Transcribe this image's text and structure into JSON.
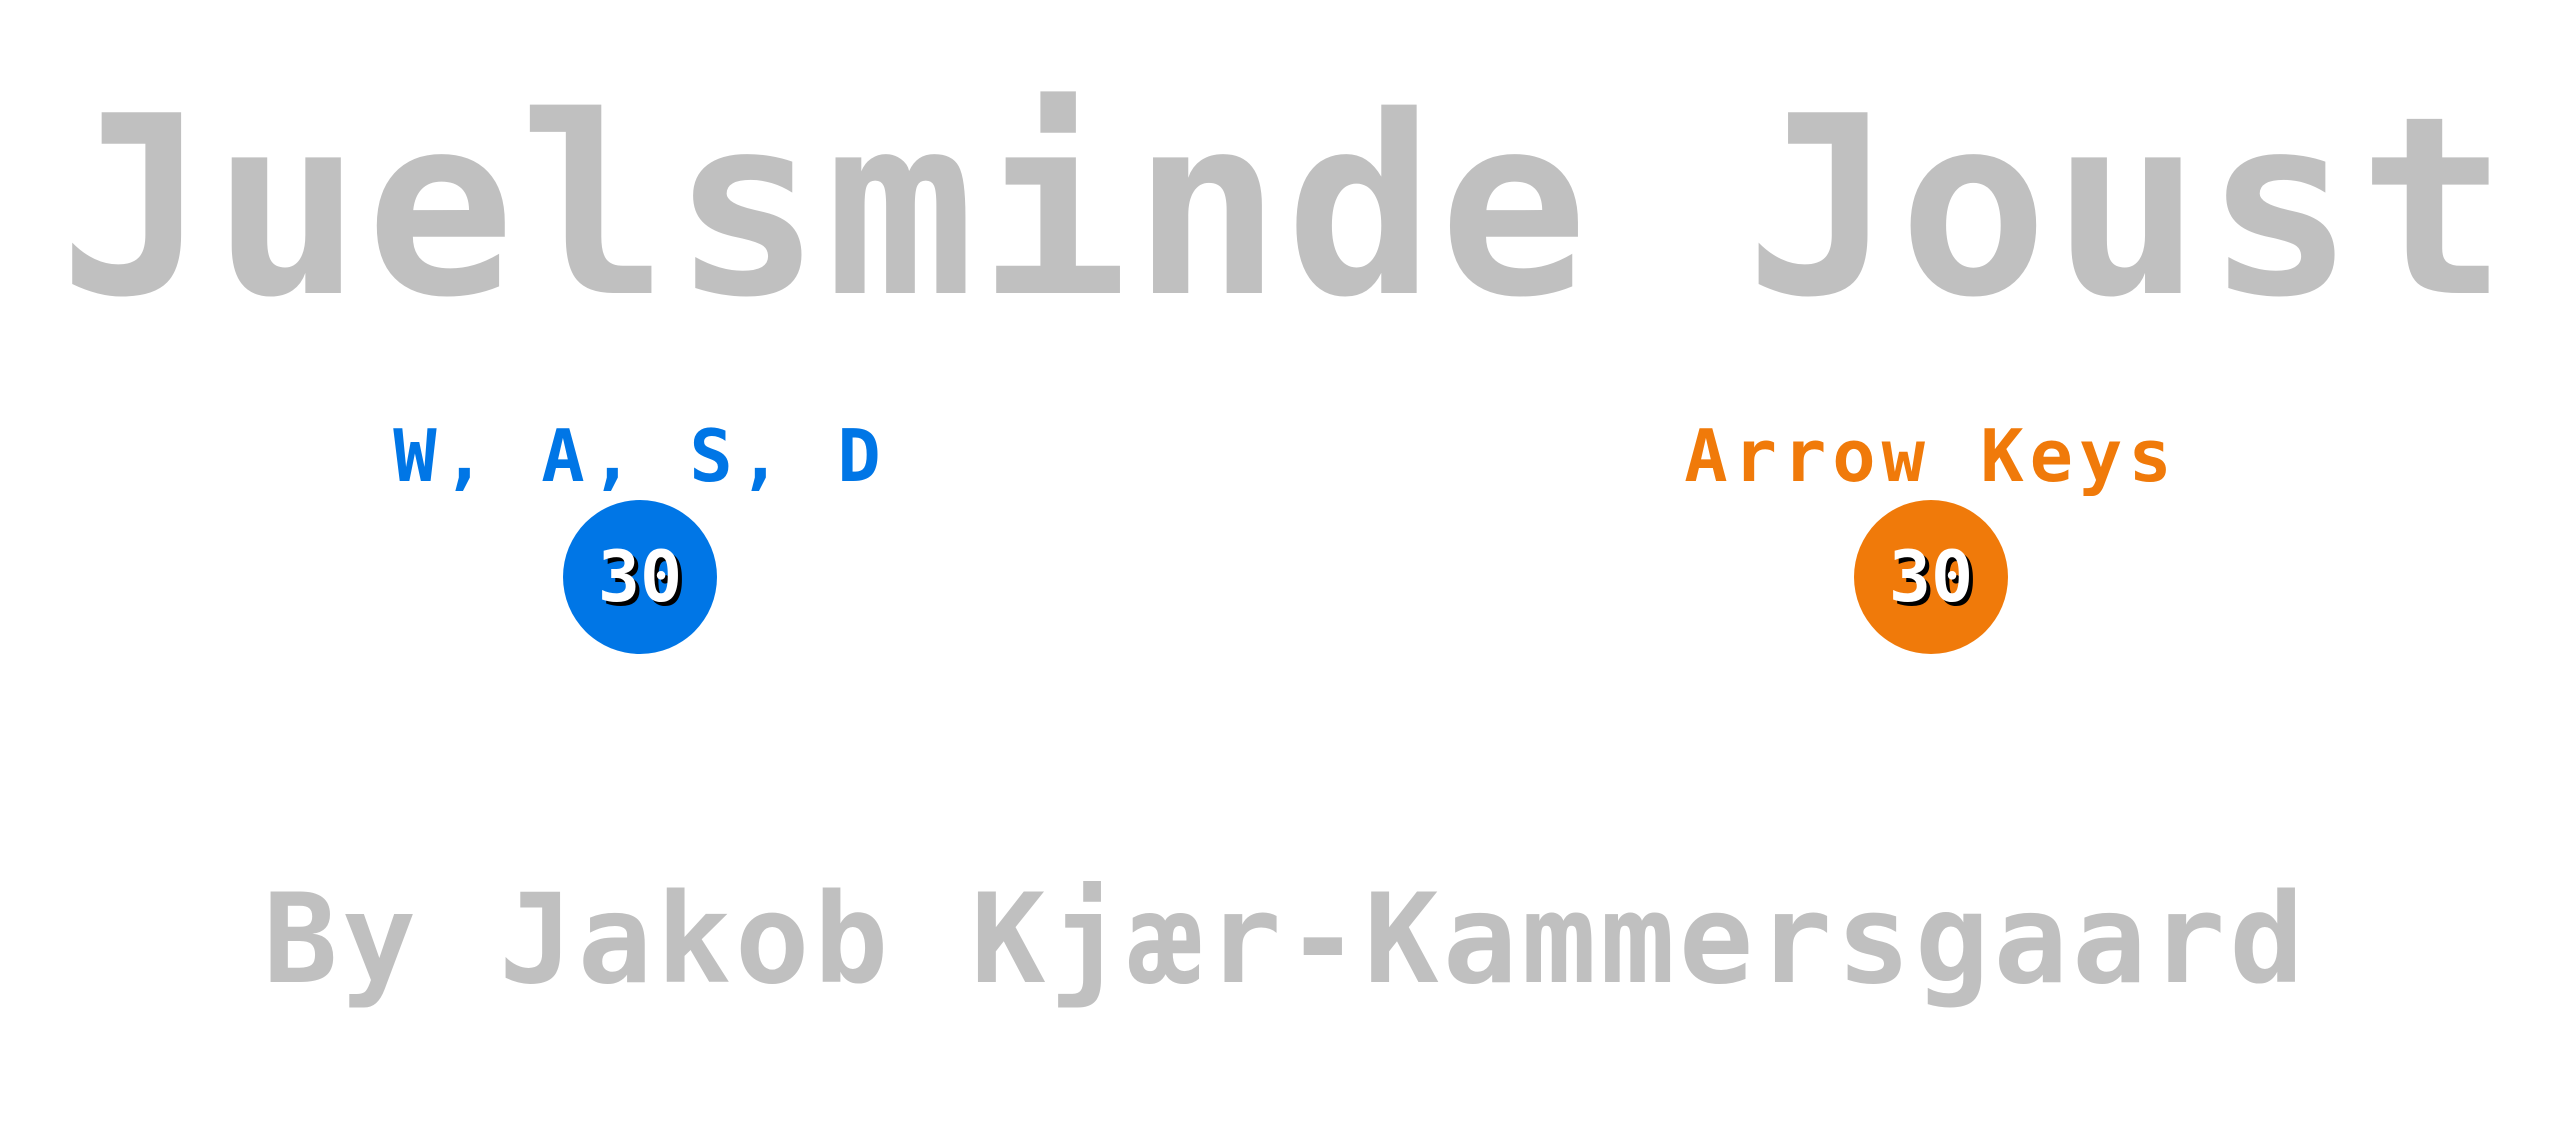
{
  "title": "Juelsminde Joust",
  "colors": {
    "title": "#c0c0c0",
    "player1": "#0076e6",
    "player2": "#f07a0a",
    "score_text": "#ffffff",
    "score_shadow": "#000000",
    "background": "#ffffff"
  },
  "players": [
    {
      "controls": "W, A, S, D",
      "score": "30"
    },
    {
      "controls": "Arrow Keys",
      "score": "30"
    }
  ],
  "byline": "By Jakob Kjær-Kammersgaard"
}
